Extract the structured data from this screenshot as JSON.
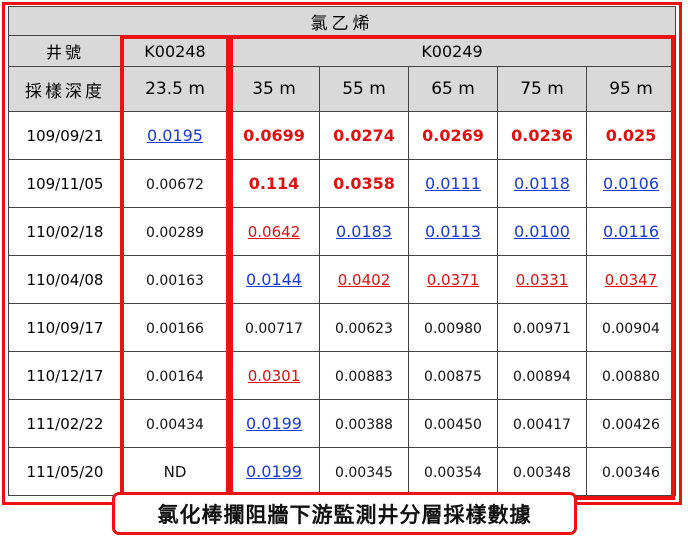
{
  "title": "氯乙烯",
  "header": {
    "well_label": "井號",
    "depth_label": "採樣深度"
  },
  "wells": [
    "K00248",
    "K00249"
  ],
  "depths": [
    "23.5 m",
    "35 m",
    "55 m",
    "65 m",
    "75 m",
    "95 m"
  ],
  "rows": [
    {
      "date": "109/09/21",
      "values": [
        "0.0195",
        "0.0699",
        "0.0274",
        "0.0269",
        "0.0236",
        "0.025"
      ]
    },
    {
      "date": "109/11/05",
      "values": [
        "0.00672",
        "0.114",
        "0.0358",
        "0.0111",
        "0.0118",
        "0.0106"
      ]
    },
    {
      "date": "110/02/18",
      "values": [
        "0.00289",
        "0.0642",
        "0.0183",
        "0.0113",
        "0.0100",
        "0.0116"
      ]
    },
    {
      "date": "110/04/08",
      "values": [
        "0.00163",
        "0.0144",
        "0.0402",
        "0.0371",
        "0.0331",
        "0.0347"
      ]
    },
    {
      "date": "110/09/17",
      "values": [
        "0.00166",
        "0.00717",
        "0.00623",
        "0.00980",
        "0.00971",
        "0.00904"
      ]
    },
    {
      "date": "110/12/17",
      "values": [
        "0.00164",
        "0.0301",
        "0.00883",
        "0.00875",
        "0.00894",
        "0.00880"
      ]
    },
    {
      "date": "111/02/22",
      "values": [
        "0.00434",
        "0.0199",
        "0.00388",
        "0.00450",
        "0.00417",
        "0.00426"
      ]
    },
    {
      "date": "111/05/20",
      "values": [
        "ND",
        "0.0199",
        "0.00345",
        "0.00354",
        "0.00348",
        "0.00346"
      ]
    }
  ],
  "styles": [
    [
      "blue",
      "red-b",
      "red-b",
      "red-b",
      "red-b",
      "red-b"
    ],
    [
      "black",
      "red-b",
      "red-b",
      "blue",
      "blue",
      "blue"
    ],
    [
      "black",
      "red-u",
      "blue",
      "blue",
      "blue",
      "blue"
    ],
    [
      "black",
      "blue",
      "red-u",
      "red-u",
      "red-u",
      "red-u"
    ],
    [
      "black",
      "black",
      "black",
      "black",
      "black",
      "black"
    ],
    [
      "black",
      "red-u",
      "black",
      "black",
      "black",
      "black"
    ],
    [
      "black",
      "blue",
      "black",
      "black",
      "black",
      "black"
    ],
    [
      "nd",
      "blue",
      "black",
      "black",
      "black",
      "black"
    ]
  ],
  "colors": {
    "highlight": "#e11111",
    "blue": "#1a3bd6",
    "red": "#e01010",
    "header_bg": "#d9d9d9"
  },
  "caption": "氯化棒攔阻牆下游監測井分層採樣數據"
}
